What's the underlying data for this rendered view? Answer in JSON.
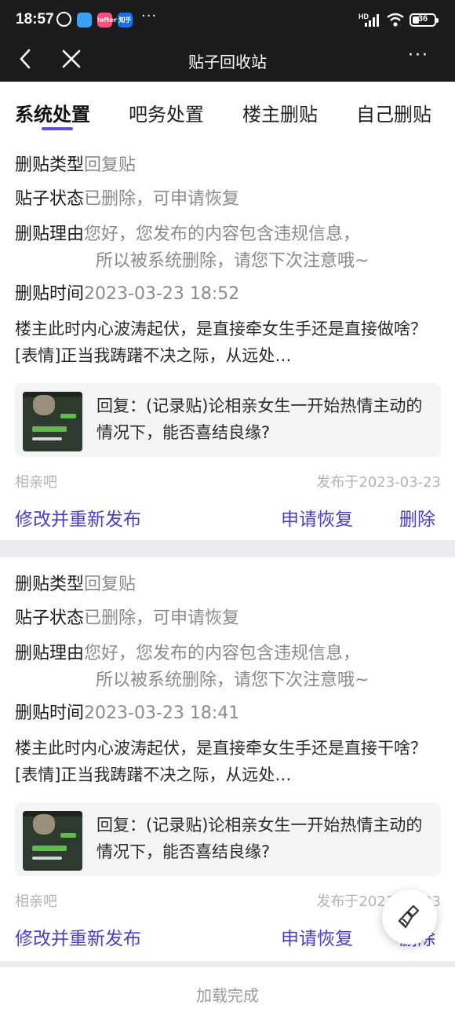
{
  "status_bar": {
    "time": "18:57",
    "apps": [
      "",
      "lofter",
      "知乎"
    ],
    "more": "···",
    "network": "HD",
    "battery": "36"
  },
  "nav": {
    "title": "贴子回收站",
    "more": "···"
  },
  "tabs": [
    {
      "label": "系统处置",
      "active": true
    },
    {
      "label": "吧务处置",
      "active": false
    },
    {
      "label": "楼主删贴",
      "active": false
    },
    {
      "label": "自己删贴",
      "active": false
    }
  ],
  "labels": {
    "type": "删贴类型",
    "status": "贴子状态",
    "reason": "删贴理由",
    "time": "删贴时间"
  },
  "posts": [
    {
      "type": "回复贴",
      "status": "已删除，可申请恢复",
      "reason_line1": "您好，您发布的内容包含违规信息，",
      "reason_line2": "所以被系统删除，请您下次注意哦~",
      "time": "2023-03-23 18:52",
      "content": "楼主此时内心波涛起伏，是直接牵女生手还是直接做啥？[表情]正当我踌躇不决之际，从远处…",
      "quote": "回复：(记录贴)论相亲女生一开始热情主动的情况下，能否喜结良缘?",
      "forum": "相亲吧",
      "published": "发布于2023-03-23",
      "actions": {
        "edit": "修改并重新发布",
        "restore": "申请恢复",
        "delete": "删除"
      }
    },
    {
      "type": "回复贴",
      "status": "已删除，可申请恢复",
      "reason_line1": "您好，您发布的内容包含违规信息，",
      "reason_line2": "所以被系统删除，请您下次注意哦~",
      "time": "2023-03-23 18:41",
      "content": "楼主此时内心波涛起伏，是直接牵女生手还是直接干啥？[表情]正当我踌躇不决之际，从远处…",
      "quote": "回复：(记录贴)论相亲女生一开始热情主动的情况下，能否喜结良缘?",
      "forum": "相亲吧",
      "published": "发布于2023-03-23",
      "actions": {
        "edit": "修改并重新发布",
        "restore": "申请恢复",
        "delete": "删除"
      }
    }
  ],
  "footer": {
    "text": "加载完成"
  },
  "colors": {
    "accent": "#4a3fc4",
    "indicator": "#5c4fdb",
    "topbar": "#1c1c1e"
  }
}
